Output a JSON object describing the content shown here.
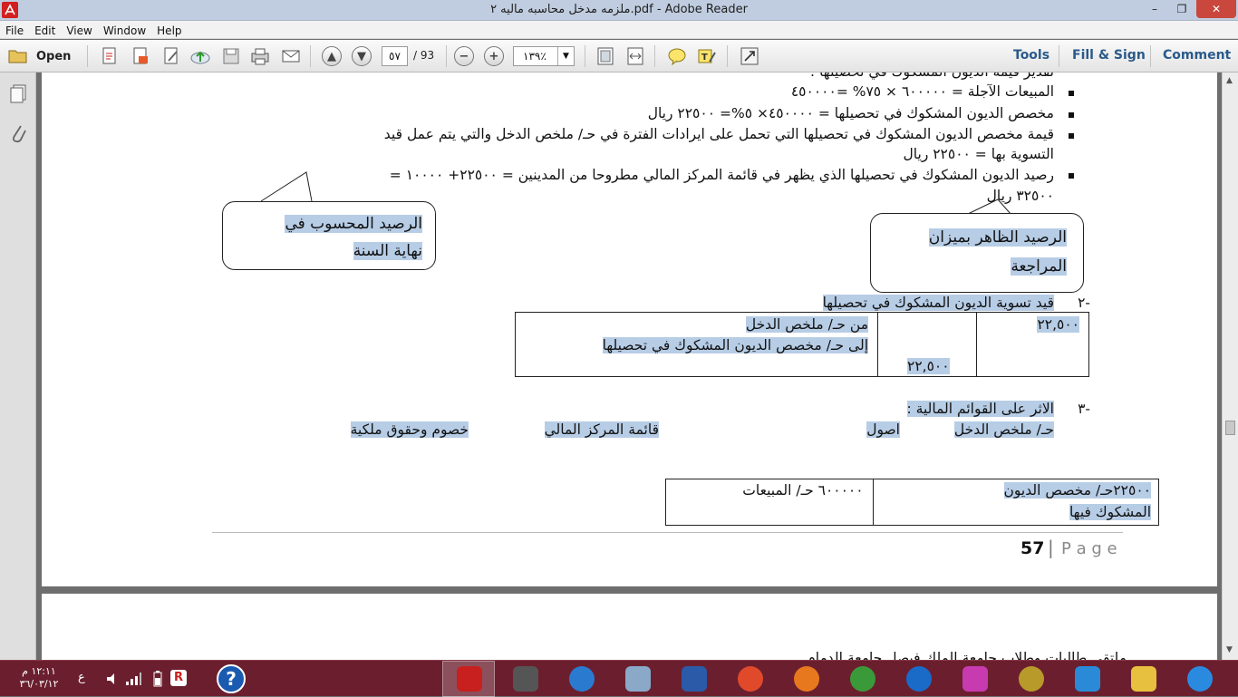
{
  "window": {
    "title": "ملزمه مدخل محاسبه ماليه ٢.pdf - Adobe Reader",
    "minimize_glyph": "–",
    "restore_glyph": "❐",
    "close_glyph": "✕"
  },
  "menu": [
    "File",
    "Edit",
    "View",
    "Window",
    "Help"
  ],
  "toolbar": {
    "open_label": "Open",
    "page_current": "٥٧",
    "page_total": "/ 93",
    "zoom": "١٣٩٪",
    "tools": "Tools",
    "fill_sign": "Fill & Sign",
    "comment": "Comment"
  },
  "doc": {
    "cut_line": "تقدير قيمة الديون المشكوك في تحصيلها :",
    "line1": "المبيعات الآجلة = ٦٠٠٠٠٠ × ٧٥% =٤٥٠٠٠٠",
    "line2": "مخصص الديون المشكوك في تحصيلها = ٤٥٠٠٠٠× ٥%= ٢٢٥٠٠ ريال",
    "line3a": "قيمة مخصص  الديون المشكوك في تحصيلها التي تحمل على ايرادات الفترة في حـ/ ملخص الدخل والتي يتم عمل قيد",
    "line3b": "التسوية بها = ٢٢٥٠٠ ريال",
    "line4a": "رصيد الديون المشكوك  في تحصيلها الذي يظهر في قائمة المركز المالي  مطروحا من المدينين = ٢٢٥٠٠+ ١٠٠٠٠ =",
    "line4b": "٣٢٥٠٠ ريال",
    "callout_left_1": "الرصيد المحسوب في",
    "callout_left_2": "نهاية السنة",
    "callout_right_1": "الرصيد الظاهر بميزان",
    "callout_right_2": "المراجعة",
    "sec2_num": "-٢",
    "sec2_title": "قيد تسوية الديون المشكوك في تحصيلها",
    "entry_debit": "٢٢,٥٠٠",
    "entry_credit": "٢٢,٥٠٠",
    "entry_from": "من حـ/ ملخص الدخل",
    "entry_to": "إلى حـ/ مخصص الديون المشكوك في تحصيلها",
    "sec3_num": "-٣",
    "sec3_title": "الاثر على القوائم المالية :",
    "h_income": "حـ/ ملخص الدخل",
    "h_assets": "اصول",
    "h_position": "قائمة المركز المالي",
    "h_liab": "خصوم وحقوق ملكية",
    "box_right_1": "٢٢٥٠٠حـ/ مخصص الديون",
    "box_right_2": "المشكوك فيها",
    "box_left": "٦٠٠٠٠٠ حـ/ المبيعات",
    "page_num": "57",
    "page_sep": "|",
    "page_word": "P a g e",
    "page2_text": "ملتقى طالبات وطلاب جامعة الملك فيصل جامعة الدمام"
  },
  "tray": {
    "time": "١٢:١١ م",
    "date": "٣٦/٠٣/١٢",
    "lang": "ع",
    "help_glyph": "?"
  },
  "taskbar_apps": [
    {
      "name": "adobe-reader",
      "color": "#c8201e"
    },
    {
      "name": "microphone",
      "color": "#555555"
    },
    {
      "name": "browser-swirl",
      "color": "#2a7ad0"
    },
    {
      "name": "calculator",
      "color": "#8aa8c8"
    },
    {
      "name": "word",
      "color": "#2b5aa8"
    },
    {
      "name": "app-r",
      "color": "#e04a2a"
    },
    {
      "name": "firefox",
      "color": "#e8781e"
    },
    {
      "name": "chrome",
      "color": "#3a9a3a"
    },
    {
      "name": "hp",
      "color": "#1a6ac8"
    },
    {
      "name": "puzzle",
      "color": "#c83ab0"
    },
    {
      "name": "media-disc",
      "color": "#b89a2a"
    },
    {
      "name": "tool-blue",
      "color": "#2a8ad8"
    },
    {
      "name": "folder",
      "color": "#e8c040"
    },
    {
      "name": "internet-explorer",
      "color": "#2a8ae0"
    }
  ]
}
